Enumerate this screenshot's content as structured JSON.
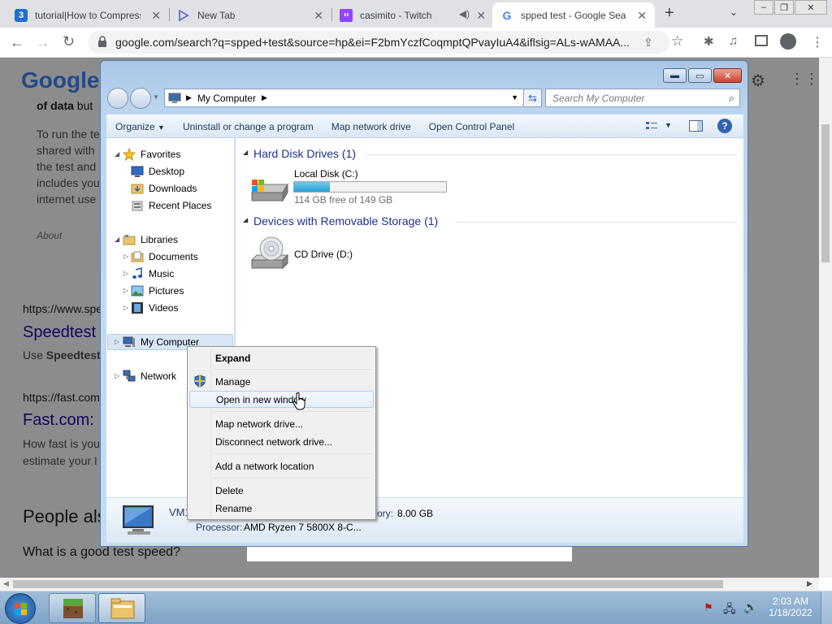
{
  "browser": {
    "tabs": [
      {
        "title": "tutorial|How to Compress",
        "active": false
      },
      {
        "title": "New Tab",
        "active": false
      },
      {
        "title": "casimito - Twitch",
        "active": false
      },
      {
        "title": "spped test - Google Sear",
        "active": true
      }
    ],
    "new_tab_label": "+",
    "address": "google.com/search?q=spped+test&source=hp&ei=F2bmYczfCoqmptQPvayIuA4&iflsig=ALs-wAMAA..."
  },
  "google_page": {
    "logo": "Google",
    "snippet_1": {
      "bold": "of data",
      "rest": " but"
    },
    "snippet_2": [
      "To run the te",
      "shared with ",
      "the test and ",
      "includes you",
      "internet use"
    ],
    "about": "About",
    "result_speedtest": {
      "url": "https://www.spe",
      "title": "Speedtest",
      "desc_prefix": "Use ",
      "desc_bold": "Speedtest"
    },
    "result_fast": {
      "url": "https://fast.com",
      "title": "Fast.com:",
      "desc": [
        "How fast is you",
        "estimate your I"
      ]
    },
    "people_also": "People als",
    "question": "What is a good test speed?"
  },
  "explorer": {
    "address_path": "My Computer",
    "search_placeholder": "Search My Computer",
    "commands": [
      "Organize",
      "Uninstall or change a program",
      "Map network drive",
      "Open Control Panel"
    ],
    "nav": {
      "favorites": "Favorites",
      "desktop": "Desktop",
      "downloads": "Downloads",
      "recent": "Recent Places",
      "libraries": "Libraries",
      "documents": "Documents",
      "music": "Music",
      "pictures": "Pictures",
      "videos": "Videos",
      "computer": "My Computer",
      "network": "Network"
    },
    "groups": {
      "hdd": "Hard Disk Drives (1)",
      "removable": "Devices with Removable Storage (1)"
    },
    "local_disk": {
      "name": "Local Disk (C:)",
      "free": "114 GB free of 149 GB",
      "used_fraction": 0.235
    },
    "cd_drive": {
      "name": "CD Drive (D:)"
    },
    "details": {
      "name": "VM1",
      "memory_label": "ory:",
      "memory_value": "8.00 GB",
      "processor_label": "Processor:",
      "processor_value": "AMD Ryzen 7 5800X 8-C..."
    }
  },
  "context_menu": {
    "expand": "Expand",
    "manage": "Manage",
    "open_new": "Open in new window",
    "map_drive": "Map network drive...",
    "disconnect": "Disconnect network drive...",
    "add_location": "Add a network location",
    "delete": "Delete",
    "rename": "Rename"
  },
  "taskbar": {
    "time": "2:03 AM",
    "date": "1/18/2022"
  },
  "colors": {
    "accent": "#1a0dab",
    "explorer_frame": "#bcd5ef",
    "taskbar": "#8aaccd"
  }
}
